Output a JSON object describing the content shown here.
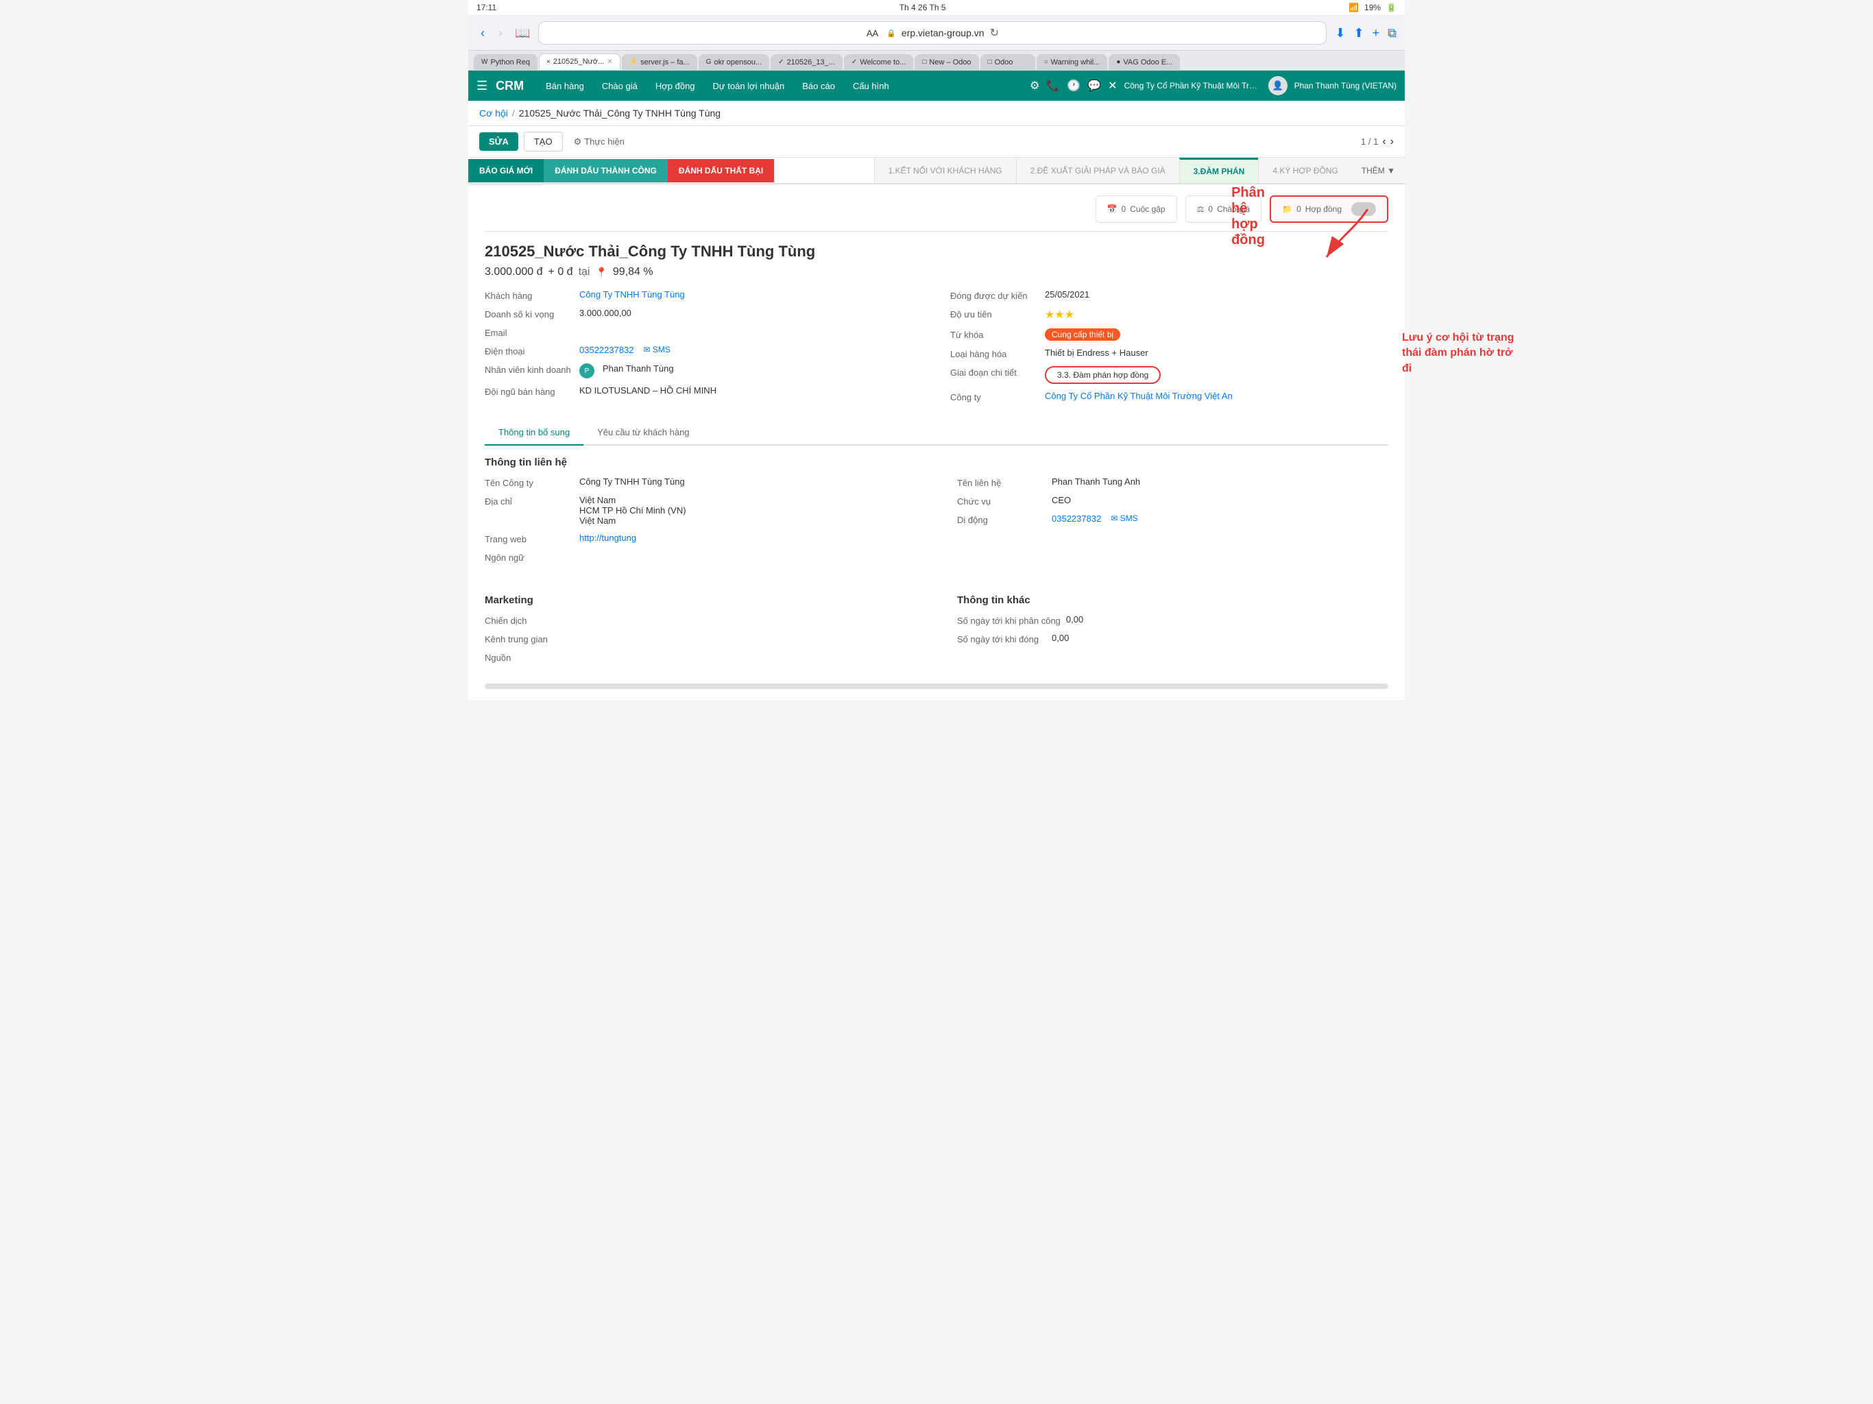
{
  "statusBar": {
    "time": "17:11",
    "date": "Th 4 26 Th 5",
    "wifi": "WiFi",
    "battery": "19%"
  },
  "browser": {
    "addressBarAA": "AA",
    "url": "erp.vietan-group.vn",
    "backBtn": "‹",
    "forwardBtn": "›"
  },
  "tabs": [
    {
      "id": "t1",
      "label": "Python Req",
      "active": false,
      "favicon": "W"
    },
    {
      "id": "t2",
      "label": "210525_Nướ...",
      "active": true,
      "favicon": "×"
    },
    {
      "id": "t3",
      "label": "server.js – fa...",
      "active": false,
      "favicon": "⚡"
    },
    {
      "id": "t4",
      "label": "okr opensou...",
      "active": false,
      "favicon": "G"
    },
    {
      "id": "t5",
      "label": "210526_13_...",
      "active": false,
      "favicon": "✓"
    },
    {
      "id": "t6",
      "label": "Welcome to...",
      "active": false,
      "favicon": "✓"
    },
    {
      "id": "t7",
      "label": "New – Odoo",
      "active": false,
      "favicon": "□"
    },
    {
      "id": "t8",
      "label": "Odoo",
      "active": false,
      "favicon": "□"
    },
    {
      "id": "t9",
      "label": "Warning whil...",
      "active": false,
      "favicon": "○"
    },
    {
      "id": "t10",
      "label": "VAG Odoo E...",
      "active": false,
      "favicon": "●"
    }
  ],
  "appNav": {
    "appName": "CRM",
    "menuItems": [
      "Bán hàng",
      "Chào giá",
      "Hợp đồng",
      "Dự toán lợi nhuận",
      "Báo cáo",
      "Cấu hình"
    ],
    "companyName": "Công Ty Cổ Phần Kỹ Thuật Môi Trường Vi...",
    "userName": "Phan Thanh Tùng (VIETAN)"
  },
  "breadcrumb": {
    "parent": "Cơ hội",
    "current": "210525_Nước Thải_Công Ty TNHH Tùng Tùng"
  },
  "actionBar": {
    "editBtn": "SỬA",
    "createBtn": "TẠO",
    "actionLabel": "Thực hiện",
    "pageInfo": "1 / 1"
  },
  "stageBtns": [
    {
      "id": "s1",
      "label": "BÁO GIÁ MỚI",
      "color": "green"
    },
    {
      "id": "s2",
      "label": "ĐÁNH DẤU THÀNH CÔNG",
      "color": "teal"
    },
    {
      "id": "s3",
      "label": "ĐÁNH DẤU THẤT BẠI",
      "color": "red"
    }
  ],
  "stageSteps": [
    {
      "id": "st1",
      "num": "1.",
      "label": "KẾT NỐI VỚI KHÁCH HÀNG",
      "active": false
    },
    {
      "id": "st2",
      "num": "2.",
      "label": "ĐỀ XUẤT GIẢI PHÁP VÀ BÁO GIÁ",
      "active": false
    },
    {
      "id": "st3",
      "num": "3.",
      "label": "ĐÀM PHÁN",
      "active": true
    },
    {
      "id": "st4",
      "num": "4.",
      "label": "KÝ HỢP ĐỒNG",
      "active": false
    }
  ],
  "moreBtn": "THÊM ▼",
  "smartButtons": {
    "meetings": {
      "count": "0",
      "label": "Cuộc gặp",
      "icon": "📅"
    },
    "quotes": {
      "count": "0",
      "label": "Chào giá",
      "icon": "⚖"
    },
    "contracts": {
      "count": "0",
      "label": "Hợp đồng",
      "icon": "📁"
    }
  },
  "record": {
    "title": "210525_Nước Thải_Công Ty TNHH Tùng Tùng",
    "amount": "3.000.000 đ",
    "amountExtra": "+ 0 đ",
    "amountLocation": "tại",
    "amountMapIcon": "📍",
    "amountPercent": "99,84 %",
    "fields": {
      "left": [
        {
          "label": "Khách hàng",
          "value": "Công Ty TNHH Tùng Tùng",
          "type": "link"
        },
        {
          "label": "Doanh số kì vọng",
          "value": "3.000.000,00",
          "type": "text"
        },
        {
          "label": "Email",
          "value": "",
          "type": "text"
        },
        {
          "label": "Điện thoại",
          "value": "03522237832",
          "type": "phone",
          "hasSMS": true
        },
        {
          "label": "Nhân viên kinh doanh",
          "value": "Phan Thanh Tùng",
          "type": "avatar"
        },
        {
          "label": "Đội ngũ bán hàng",
          "value": "KD ILOTUSLAND – HỒ CHÍ MINH",
          "type": "text"
        }
      ],
      "right": [
        {
          "label": "Đóng được dự kiến",
          "value": "25/05/2021",
          "type": "text"
        },
        {
          "label": "Độ ưu tiên",
          "value": "★★★",
          "type": "stars"
        },
        {
          "label": "Từ khóa",
          "value": "Cung cấp thiết bị",
          "type": "tag"
        },
        {
          "label": "Loại hàng hóa",
          "value": "Thiết bị Endress + Hauser",
          "type": "text"
        },
        {
          "label": "Giai đoạn chi tiết",
          "value": "3.3. Đàm phán hợp đồng",
          "type": "stage"
        },
        {
          "label": "Công ty",
          "value": "Công Ty Cổ Phần Kỹ Thuật Môi Trường Việt An",
          "type": "link"
        }
      ]
    }
  },
  "recordTabs": [
    {
      "id": "rt1",
      "label": "Thông tin bổ sung",
      "active": true
    },
    {
      "id": "rt2",
      "label": "Yêu cầu từ khách hàng",
      "active": false
    }
  ],
  "contactSection": {
    "title": "Thông tin liên hệ",
    "leftFields": [
      {
        "label": "Tên Công ty",
        "value": "Công Ty TNHH Tùng Tùng",
        "type": "text"
      },
      {
        "label": "Địa chỉ",
        "value": "Việt Nam\nHCM  TP Hồ Chí Minh (VN)\nViệt Nam",
        "type": "text"
      },
      {
        "label": "Trang web",
        "value": "http://tungtung",
        "type": "link"
      },
      {
        "label": "Ngôn ngữ",
        "value": "",
        "type": "text"
      }
    ],
    "rightFields": [
      {
        "label": "Tên liên hệ",
        "value": "Phan Thanh Tung Anh",
        "type": "text"
      },
      {
        "label": "Chức vụ",
        "value": "CEO",
        "type": "text"
      },
      {
        "label": "Di động",
        "value": "0352237832",
        "type": "phone",
        "hasSMS": true
      }
    ]
  },
  "marketingSection": {
    "title": "Marketing",
    "leftFields": [
      {
        "label": "Chiến dịch",
        "value": "",
        "type": "text"
      },
      {
        "label": "Kênh trung gian",
        "value": "",
        "type": "text"
      },
      {
        "label": "Nguồn",
        "value": "",
        "type": "text"
      }
    ]
  },
  "otherSection": {
    "title": "Thông tin khác",
    "rightFields": [
      {
        "label": "Số ngày tới khi phân công",
        "value": "0,00",
        "type": "text"
      },
      {
        "label": "Số ngày tới khi đóng",
        "value": "0,00",
        "type": "text"
      }
    ]
  },
  "annotations": {
    "contractLabel": "Phân hệ hợp đồng",
    "noteLabel": "Lưu ý cơ hội từ trạng\nthái đàm phán hờ trở\nđi"
  }
}
